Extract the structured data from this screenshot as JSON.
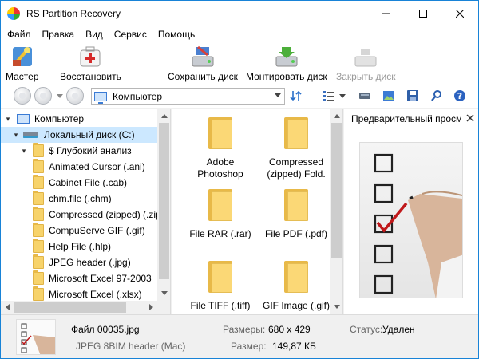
{
  "window": {
    "title": "RS Partition Recovery"
  },
  "menu": [
    "Файл",
    "Правка",
    "Вид",
    "Сервис",
    "Помощь"
  ],
  "toolbar": {
    "wizard": "Мастер",
    "restore": "Восстановить",
    "save_disk": "Сохранить диск",
    "mount_disk": "Монтировать диск",
    "close_disk": "Закрыть диск"
  },
  "address": {
    "value": "Компьютер"
  },
  "tree": {
    "root": "Компьютер",
    "disk": "Локальный диск (C:)",
    "deep": "$ Глубокий анализ",
    "folders": [
      "Animated Cursor (.ani)",
      "Cabinet File (.cab)",
      "chm.file (.chm)",
      "Compressed (zipped) (.zip)",
      "CompuServe GIF (.gif)",
      "Help File (.hlp)",
      "JPEG header (.jpg)",
      "Microsoft Excel 97-2003",
      "Microsoft Excel (.xlsx)"
    ]
  },
  "files": [
    {
      "line1": "Adobe",
      "line2": "Photoshop"
    },
    {
      "line1": "Compressed",
      "line2": "(zipped) Fold."
    },
    {
      "line1": "File RAR (.rar)",
      "line2": ""
    },
    {
      "line1": "File PDF (.pdf)",
      "line2": ""
    },
    {
      "line1": "File TIFF (.tiff)",
      "line2": ""
    },
    {
      "line1": "GIF Image (.gif)",
      "line2": ""
    }
  ],
  "preview": {
    "title": "Предварительный просм"
  },
  "status": {
    "file_name": "Файл 00035.jpg",
    "file_type": "JPEG 8BIM header (Mac)",
    "dims_label": "Размеры:",
    "dims_value": "680 x 429",
    "size_label": "Размер:",
    "size_value": "149,87 КБ",
    "state_label": "Статус:",
    "state_value": "Удален"
  },
  "colors": {
    "selection": "#cce8ff",
    "folder": "#fbd876",
    "accent": "#1883d7"
  }
}
